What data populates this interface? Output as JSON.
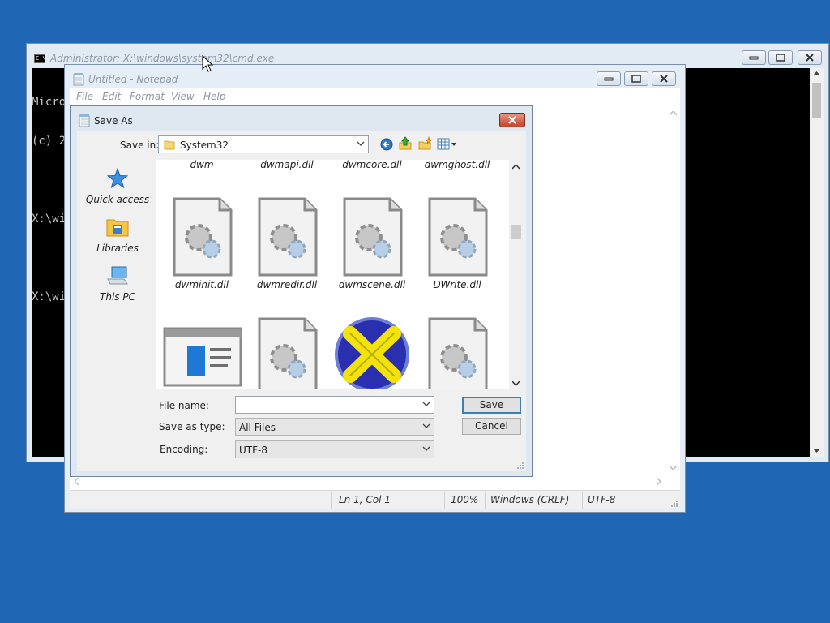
{
  "cmd": {
    "title": "Administrator: X:\\windows\\system32\\cmd.exe",
    "lines": [
      "Micro",
      "(c) 2",
      "",
      "X:\\wi",
      "",
      "X:\\wi"
    ]
  },
  "notepad": {
    "title": "Untitled - Notepad",
    "menu": [
      "File",
      "Edit",
      "Format",
      "View",
      "Help"
    ],
    "status": {
      "position": "Ln 1, Col 1",
      "zoom": "100%",
      "line_ending": "Windows (CRLF)",
      "encoding": "UTF-8"
    }
  },
  "save_as": {
    "title": "Save As",
    "save_in_label": "Save in:",
    "save_in_value": "System32",
    "places": [
      {
        "label": "Quick access",
        "icon": "star-icon"
      },
      {
        "label": "Libraries",
        "icon": "library-folder-icon"
      },
      {
        "label": "This PC",
        "icon": "computer-icon"
      }
    ],
    "files_row0": [
      "dwm",
      "dwmapi.dll",
      "dwmcore.dll",
      "dwmghost.dll"
    ],
    "files_row1": [
      "dwminit.dll",
      "dwmredir.dll",
      "dwmscene.dll",
      "DWrite.dll"
    ],
    "file_name_label": "File name:",
    "file_name_value": "",
    "save_type_label": "Save as type:",
    "save_type_value": "All Files",
    "encoding_label": "Encoding:",
    "encoding_value": "UTF-8",
    "save_button": "Save",
    "cancel_button": "Cancel"
  }
}
